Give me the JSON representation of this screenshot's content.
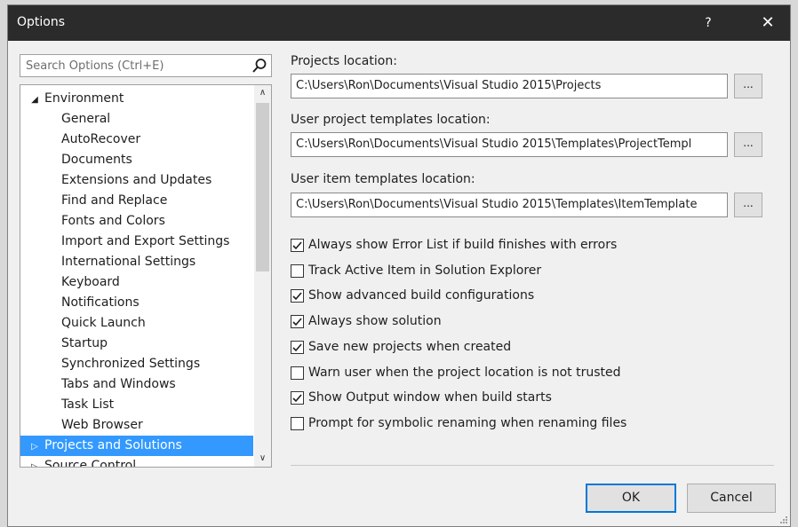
{
  "titlebar": {
    "title": "Options",
    "help_label": "?",
    "close_label": "✕"
  },
  "search": {
    "placeholder": "Search Options (Ctrl+E)",
    "value": ""
  },
  "tree": {
    "items": [
      {
        "label": "Environment",
        "arrow": "◢",
        "level": 0
      },
      {
        "label": "General",
        "level": 1
      },
      {
        "label": "AutoRecover",
        "level": 1
      },
      {
        "label": "Documents",
        "level": 1
      },
      {
        "label": "Extensions and Updates",
        "level": 1
      },
      {
        "label": "Find and Replace",
        "level": 1
      },
      {
        "label": "Fonts and Colors",
        "level": 1
      },
      {
        "label": "Import and Export Settings",
        "level": 1
      },
      {
        "label": "International Settings",
        "level": 1
      },
      {
        "label": "Keyboard",
        "level": 1
      },
      {
        "label": "Notifications",
        "level": 1
      },
      {
        "label": "Quick Launch",
        "level": 1
      },
      {
        "label": "Startup",
        "level": 1
      },
      {
        "label": "Synchronized Settings",
        "level": 1
      },
      {
        "label": "Tabs and Windows",
        "level": 1
      },
      {
        "label": "Task List",
        "level": 1
      },
      {
        "label": "Web Browser",
        "level": 1
      },
      {
        "label": "Projects and Solutions",
        "arrow": "▷",
        "level": 0,
        "selected": true
      },
      {
        "label": "Source Control",
        "arrow": "▷",
        "level": 0
      }
    ],
    "scroll_up": "∧",
    "scroll_down": "∨"
  },
  "fields": {
    "projects_location": {
      "label": "Projects location:",
      "value": "C:\\Users\\Ron\\Documents\\Visual Studio 2015\\Projects"
    },
    "project_templates": {
      "label": "User project templates location:",
      "value": "C:\\Users\\Ron\\Documents\\Visual Studio 2015\\Templates\\ProjectTempl"
    },
    "item_templates": {
      "label": "User item templates location:",
      "value": "C:\\Users\\Ron\\Documents\\Visual Studio 2015\\Templates\\ItemTemplate"
    },
    "browse_label": "..."
  },
  "checkboxes": [
    {
      "label": "Always show Error List if build finishes with errors",
      "checked": true
    },
    {
      "label": "Track Active Item in Solution Explorer",
      "checked": false
    },
    {
      "label": "Show advanced build configurations",
      "checked": true
    },
    {
      "label": "Always show solution",
      "checked": true
    },
    {
      "label": "Save new projects when created",
      "checked": true
    },
    {
      "label": "Warn user when the project location is not trusted",
      "checked": false
    },
    {
      "label": "Show Output window when build starts",
      "checked": true
    },
    {
      "label": "Prompt for symbolic renaming when renaming files",
      "checked": false
    }
  ],
  "buttons": {
    "ok": "OK",
    "cancel": "Cancel"
  },
  "colors": {
    "titlebar": "#2b2b2b",
    "selection": "#3399ff",
    "ok_border": "#0078d7"
  }
}
